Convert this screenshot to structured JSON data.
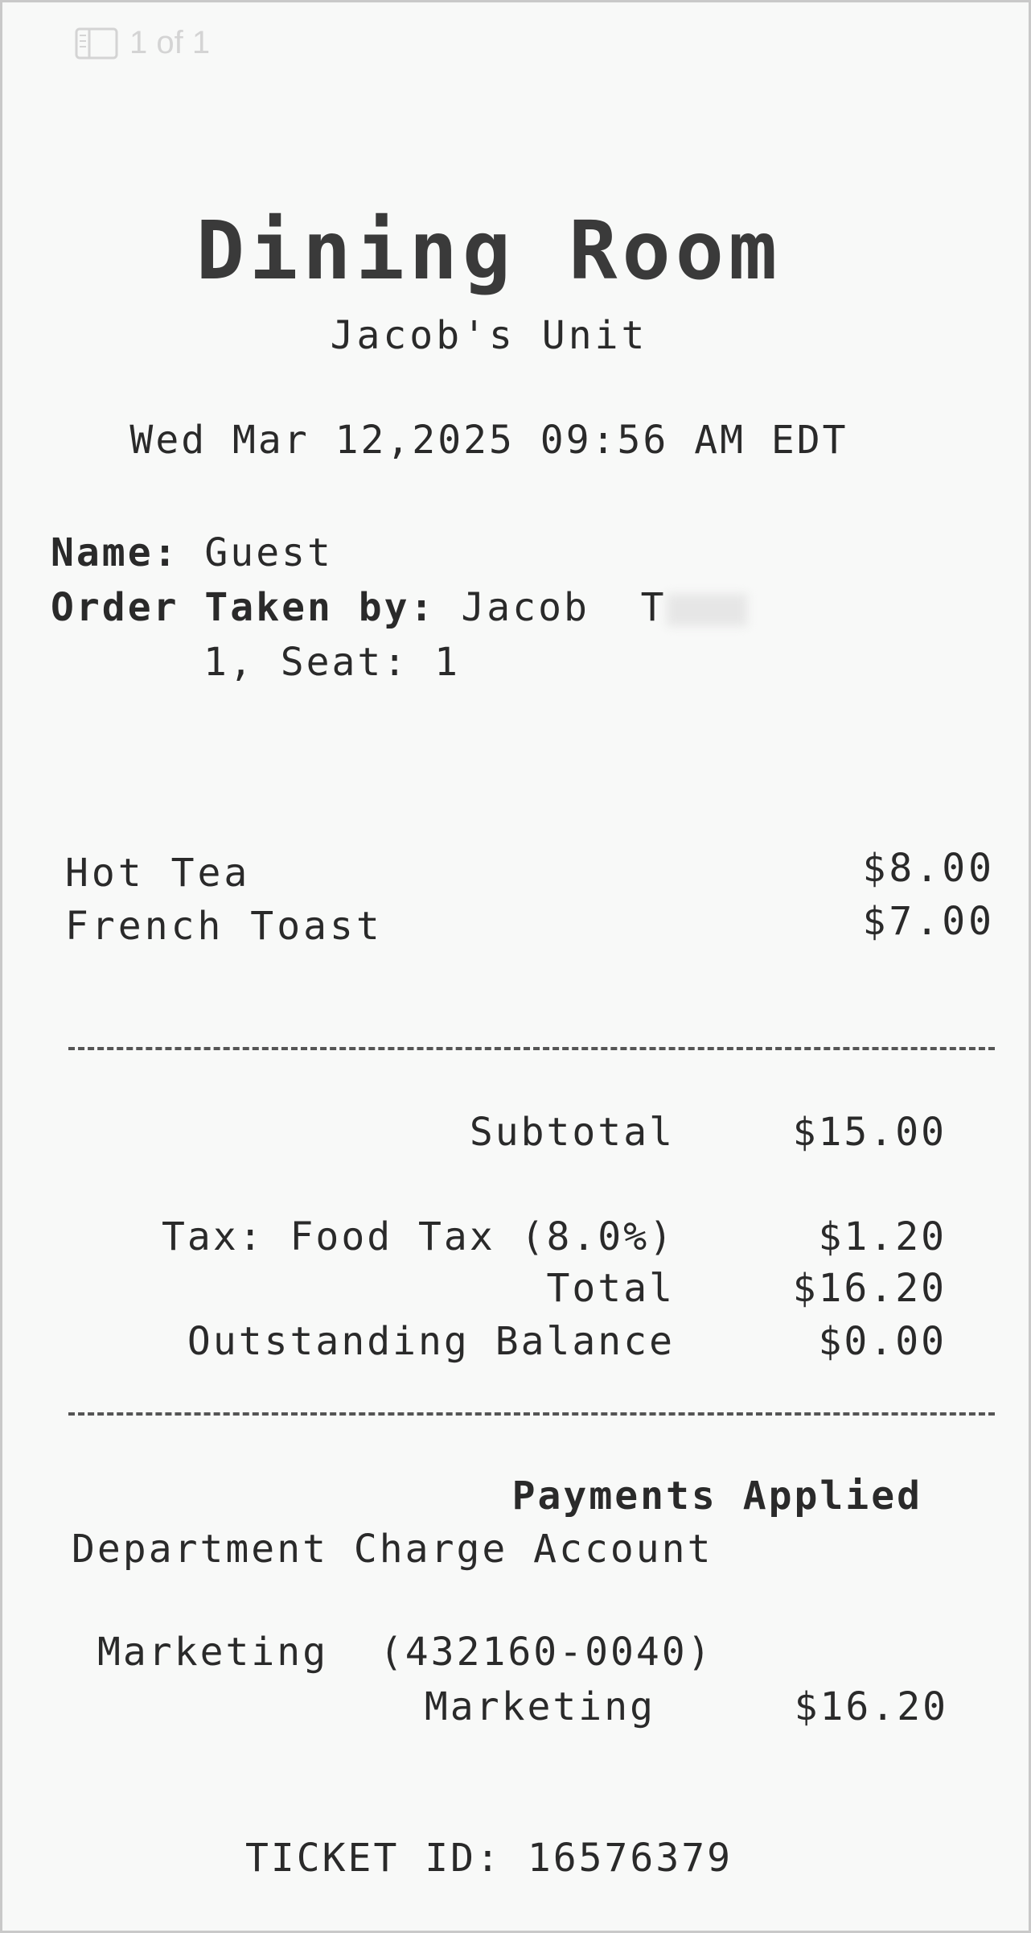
{
  "viewer": {
    "page_indicator": "1 of 1",
    "icon": "sidebar-icon"
  },
  "receipt": {
    "title": "Dining Room",
    "unit": "Jacob's Unit",
    "datetime": "Wed Mar 12,2025 09:56 AM EDT",
    "name_label": "Name:",
    "name_value": "Guest",
    "taken_label": "Order Taken by:",
    "taken_value": "Jacob  T",
    "seat_line": "1, Seat: 1",
    "items": [
      {
        "name": "Hot Tea",
        "price": "$8.00"
      },
      {
        "name": "French Toast",
        "price": "$7.00"
      }
    ],
    "subtotal_label": "Subtotal",
    "subtotal_value": "$15.00",
    "tax_label": "Tax: Food Tax (8.0%)",
    "tax_value": "$1.20",
    "total_label": "Total",
    "total_value": "$16.20",
    "balance_label": "Outstanding Balance",
    "balance_value": "$0.00",
    "payments_heading": "Payments Applied",
    "payment_method": "Department Charge Account",
    "account_line": "Marketing  (432160-0040)",
    "account_name": "Marketing",
    "account_amount": "$16.20",
    "ticket_line": "TICKET ID: 16576379"
  }
}
